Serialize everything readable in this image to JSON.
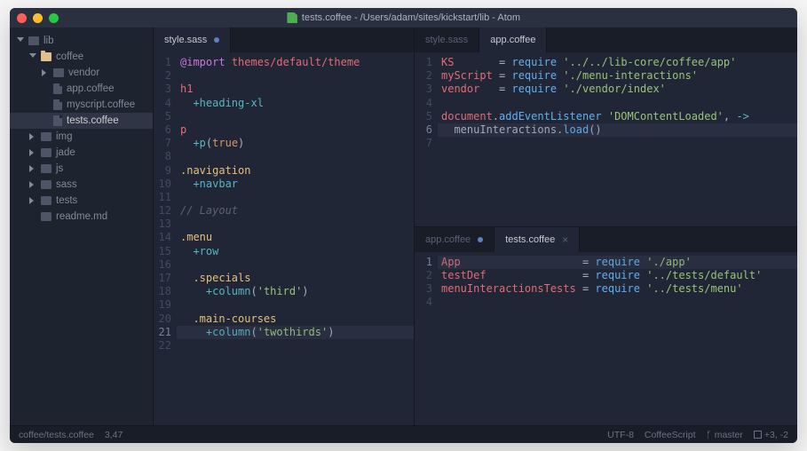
{
  "window": {
    "title": "tests.coffee - /Users/adam/sites/kickstart/lib - Atom"
  },
  "sidebar": {
    "items": [
      {
        "depth": 0,
        "caret": "down",
        "icon": "folder-open",
        "label": "lib"
      },
      {
        "depth": 1,
        "caret": "down",
        "icon": "folder",
        "label": "coffee"
      },
      {
        "depth": 2,
        "caret": "right",
        "icon": "folder-open",
        "label": "vendor"
      },
      {
        "depth": 2,
        "caret": "blank",
        "icon": "file",
        "label": "app.coffee"
      },
      {
        "depth": 2,
        "caret": "blank",
        "icon": "file",
        "label": "myscript.coffee"
      },
      {
        "depth": 2,
        "caret": "blank",
        "icon": "file",
        "label": "tests.coffee",
        "active": true
      },
      {
        "depth": 1,
        "caret": "right",
        "icon": "folder-open",
        "label": "img"
      },
      {
        "depth": 1,
        "caret": "right",
        "icon": "folder-open",
        "label": "jade"
      },
      {
        "depth": 1,
        "caret": "right",
        "icon": "folder-open",
        "label": "js"
      },
      {
        "depth": 1,
        "caret": "right",
        "icon": "folder-open",
        "label": "sass"
      },
      {
        "depth": 1,
        "caret": "right",
        "icon": "folder-open",
        "label": "tests"
      },
      {
        "depth": 1,
        "caret": "blank",
        "icon": "book",
        "label": "readme.md"
      }
    ]
  },
  "left_pane": {
    "tabs": [
      {
        "label": "style.sass",
        "modified": true,
        "active": true
      }
    ],
    "cursor_line_index": 20,
    "lines": [
      [
        {
          "c": "kw",
          "t": "@import"
        },
        {
          "c": "plain",
          "t": " "
        },
        {
          "c": "red",
          "t": "themes/default/theme"
        }
      ],
      [],
      [
        {
          "c": "red",
          "t": "h1"
        }
      ],
      [
        {
          "c": "plain",
          "t": "  "
        },
        {
          "c": "cyan",
          "t": "+heading-xl"
        }
      ],
      [],
      [
        {
          "c": "red",
          "t": "p"
        }
      ],
      [
        {
          "c": "plain",
          "t": "  "
        },
        {
          "c": "cyan",
          "t": "+p"
        },
        {
          "c": "plain",
          "t": "("
        },
        {
          "c": "orng",
          "t": "true"
        },
        {
          "c": "plain",
          "t": ")"
        }
      ],
      [],
      [
        {
          "c": "yel",
          "t": ".navigation"
        }
      ],
      [
        {
          "c": "plain",
          "t": "  "
        },
        {
          "c": "cyan",
          "t": "+navbar"
        }
      ],
      [],
      [
        {
          "c": "cmt",
          "t": "// Layout"
        }
      ],
      [],
      [
        {
          "c": "yel",
          "t": ".menu"
        }
      ],
      [
        {
          "c": "plain",
          "t": "  "
        },
        {
          "c": "cyan",
          "t": "+row"
        }
      ],
      [],
      [
        {
          "c": "plain",
          "t": "  "
        },
        {
          "c": "yel",
          "t": ".specials"
        }
      ],
      [
        {
          "c": "plain",
          "t": "    "
        },
        {
          "c": "cyan",
          "t": "+column"
        },
        {
          "c": "plain",
          "t": "("
        },
        {
          "c": "grn",
          "t": "'third'"
        },
        {
          "c": "plain",
          "t": ")"
        }
      ],
      [],
      [
        {
          "c": "plain",
          "t": "  "
        },
        {
          "c": "yel",
          "t": ".main-courses"
        }
      ],
      [
        {
          "c": "plain",
          "t": "    "
        },
        {
          "c": "cyan",
          "t": "+column"
        },
        {
          "c": "plain",
          "t": "("
        },
        {
          "c": "grn",
          "t": "'twothirds'"
        },
        {
          "c": "plain",
          "t": ")"
        }
      ],
      []
    ]
  },
  "right_top": {
    "tabs": [
      {
        "label": "style.sass",
        "modified": false,
        "active": false
      },
      {
        "label": "app.coffee",
        "modified": false,
        "active": true
      }
    ],
    "cursor_line_index": 5,
    "lines": [
      [
        {
          "c": "red",
          "t": "KS"
        },
        {
          "c": "plain",
          "t": "       "
        },
        {
          "c": "op",
          "t": "= "
        },
        {
          "c": "blue",
          "t": "require"
        },
        {
          "c": "plain",
          "t": " "
        },
        {
          "c": "grn",
          "t": "'../../lib-core/coffee/app'"
        }
      ],
      [
        {
          "c": "red",
          "t": "myScript"
        },
        {
          "c": "plain",
          "t": " "
        },
        {
          "c": "op",
          "t": "= "
        },
        {
          "c": "blue",
          "t": "require"
        },
        {
          "c": "plain",
          "t": " "
        },
        {
          "c": "grn",
          "t": "'./menu-interactions'"
        }
      ],
      [
        {
          "c": "red",
          "t": "vendor"
        },
        {
          "c": "plain",
          "t": "   "
        },
        {
          "c": "op",
          "t": "= "
        },
        {
          "c": "blue",
          "t": "require"
        },
        {
          "c": "plain",
          "t": " "
        },
        {
          "c": "grn",
          "t": "'./vendor/index'"
        }
      ],
      [],
      [
        {
          "c": "red",
          "t": "document"
        },
        {
          "c": "plain",
          "t": "."
        },
        {
          "c": "blue",
          "t": "addEventListener"
        },
        {
          "c": "plain",
          "t": " "
        },
        {
          "c": "grn",
          "t": "'DOMContentLoaded'"
        },
        {
          "c": "plain",
          "t": ", "
        },
        {
          "c": "cyan",
          "t": "->"
        }
      ],
      [
        {
          "c": "plain",
          "t": "  menuInteractions."
        },
        {
          "c": "blue",
          "t": "load"
        },
        {
          "c": "plain",
          "t": "()"
        }
      ],
      []
    ]
  },
  "right_bottom": {
    "tabs": [
      {
        "label": "app.coffee",
        "modified": true,
        "active": false
      },
      {
        "label": "tests.coffee",
        "modified": false,
        "active": true,
        "closable": true
      }
    ],
    "cursor_line_index": 0,
    "lines": [
      [
        {
          "c": "red",
          "t": "App"
        },
        {
          "c": "plain",
          "t": "                   "
        },
        {
          "c": "op",
          "t": "= "
        },
        {
          "c": "blue",
          "t": "require"
        },
        {
          "c": "plain",
          "t": " "
        },
        {
          "c": "grn",
          "t": "'./app'"
        }
      ],
      [
        {
          "c": "red",
          "t": "testDef"
        },
        {
          "c": "plain",
          "t": "               "
        },
        {
          "c": "op",
          "t": "= "
        },
        {
          "c": "blue",
          "t": "require"
        },
        {
          "c": "plain",
          "t": " "
        },
        {
          "c": "grn",
          "t": "'../tests/default'"
        }
      ],
      [
        {
          "c": "red",
          "t": "menuInteractionsTests"
        },
        {
          "c": "plain",
          "t": " "
        },
        {
          "c": "op",
          "t": "= "
        },
        {
          "c": "blue",
          "t": "require"
        },
        {
          "c": "plain",
          "t": " "
        },
        {
          "c": "grn",
          "t": "'../tests/menu'"
        }
      ],
      []
    ]
  },
  "statusbar": {
    "path": "coffee/tests.coffee",
    "cursor": "3,47",
    "encoding": "UTF-8",
    "grammar": "CoffeeScript",
    "branch": "master",
    "diff": "+3, -2"
  }
}
